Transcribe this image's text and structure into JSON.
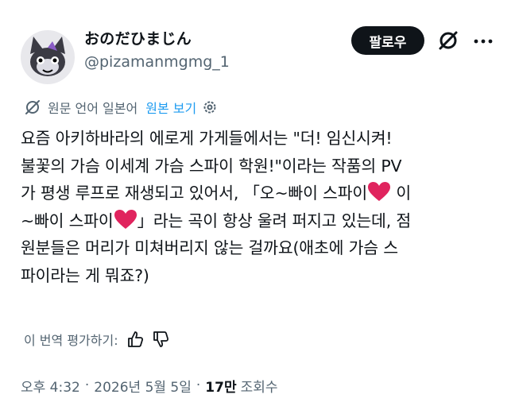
{
  "author": {
    "display_name": "おのだひまじん",
    "handle": "@pizamanmgmg_1"
  },
  "actions": {
    "follow_label": "팔로우"
  },
  "icons": {
    "avatar": "cartoon-cat-avatar",
    "grok": "grok-icon",
    "more": "more-dots-icon",
    "translate": "globe-translate-icon",
    "settings": "gear-icon",
    "like": "thumbs-up-icon",
    "dislike": "thumbs-down-icon",
    "heart": "red-heart-emoji"
  },
  "translation": {
    "source_label": "원문 언어 일본어",
    "show_original_label": "원본 보기",
    "rate_label": "이 번역 평가하기:"
  },
  "tweet": {
    "text_part1": "요즘 아키하바라의 에로게 가게들에서는 \"더! 임신시켜!\n불꽃의 가슴 이세계 가슴 스파이 학원!\"이라는 작품의 PV\n가 평생 루프로 재생되고 있어서, 「오~빠이 스파이",
    "text_part2": " 이\n~빠이 스파이",
    "text_part3": "」라는 곡이 항상 울려 퍼지고 있는데, 점\n원분들은 머리가 미쳐버리지 않는 걸까요(애초에 가슴 스\n파이라는 게 뭐죠?)"
  },
  "meta": {
    "time": "오후 4:32",
    "sep": "·",
    "date": "2026년 5월 5일",
    "views_count": "17만",
    "views_label": "조회수"
  },
  "colors": {
    "text": "#0f1419",
    "secondary": "#536471",
    "link": "#1d9bf0",
    "heart": "#e0245e"
  }
}
